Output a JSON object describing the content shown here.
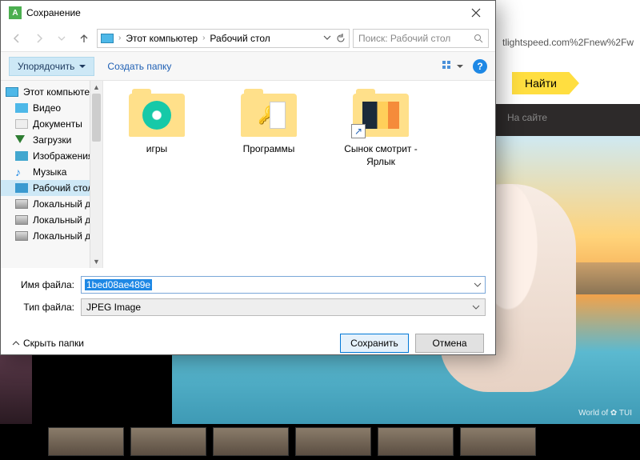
{
  "browser": {
    "url_fragment": "tlightspeed.com%2Fnew%2Fw",
    "find_button": "Найти",
    "tab_label": "На сайте",
    "watermark": "World of ✿ TUI"
  },
  "dialog": {
    "title": "Сохранение",
    "breadcrumb": {
      "root": "Этот компьютер",
      "current": "Рабочий стол"
    },
    "search_placeholder": "Поиск: Рабочий стол",
    "toolbar": {
      "organize": "Упорядочить",
      "new_folder": "Создать папку"
    },
    "sidebar": [
      {
        "label": "Этот компьютер",
        "icon": "pc",
        "root": true
      },
      {
        "label": "Видео",
        "icon": "video"
      },
      {
        "label": "Документы",
        "icon": "doc"
      },
      {
        "label": "Загрузки",
        "icon": "down"
      },
      {
        "label": "Изображения",
        "icon": "img"
      },
      {
        "label": "Музыка",
        "icon": "music"
      },
      {
        "label": "Рабочий стол",
        "icon": "desk",
        "selected": true
      },
      {
        "label": "Локальный дис",
        "icon": "disk"
      },
      {
        "label": "Локальный дис",
        "icon": "disk"
      },
      {
        "label": "Локальный дис",
        "icon": "disk"
      }
    ],
    "files": [
      {
        "name": "игры",
        "type": "folder",
        "inner": "disc"
      },
      {
        "name": "Программы",
        "type": "folder",
        "inner": "key"
      },
      {
        "name": "Сынок смотрит - Ярлык",
        "type": "shortcut",
        "inner": "photo"
      }
    ],
    "filename_label": "Имя файла:",
    "filename_value": "1bed08ae489e",
    "filetype_label": "Тип файла:",
    "filetype_value": "JPEG Image",
    "hide_folders": "Скрыть папки",
    "save_button": "Сохранить",
    "cancel_button": "Отмена"
  }
}
